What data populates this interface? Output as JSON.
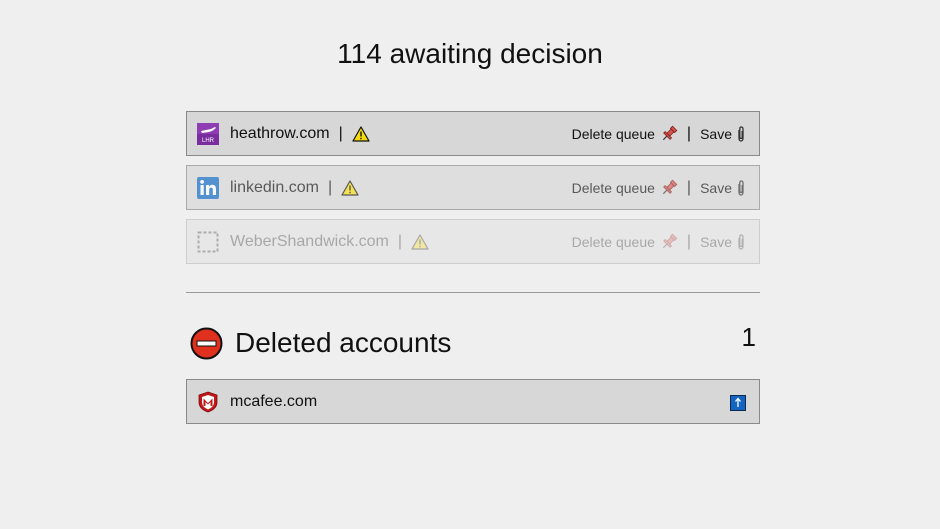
{
  "header": {
    "title": "114 awaiting decision"
  },
  "queue": [
    {
      "domain": "heathrow.com",
      "favicon": "heathrow-logo",
      "delete_label": "Delete queue",
      "save_label": "Save",
      "warning_icon": "warning-icon"
    },
    {
      "domain": "linkedin.com",
      "favicon": "linkedin-logo",
      "delete_label": "Delete queue",
      "save_label": "Save",
      "warning_icon": "warning-icon"
    },
    {
      "domain": "WeberShandwick.com",
      "favicon": "placeholder-favicon",
      "delete_label": "Delete queue",
      "save_label": "Save",
      "warning_icon": "warning-icon"
    }
  ],
  "deleted": {
    "title": "Deleted accounts",
    "count": "1",
    "items": [
      {
        "domain": "mcafee.com",
        "favicon": "mcafee-logo",
        "action_icon": "restore-icon"
      }
    ]
  },
  "colors": {
    "background": "#efefef",
    "row_background": "#d7d7d7",
    "row_border": "#8a8a8a",
    "deleted_icon": "#e0301e",
    "pin": "#d9534f",
    "restore_button": "#1565c0"
  }
}
